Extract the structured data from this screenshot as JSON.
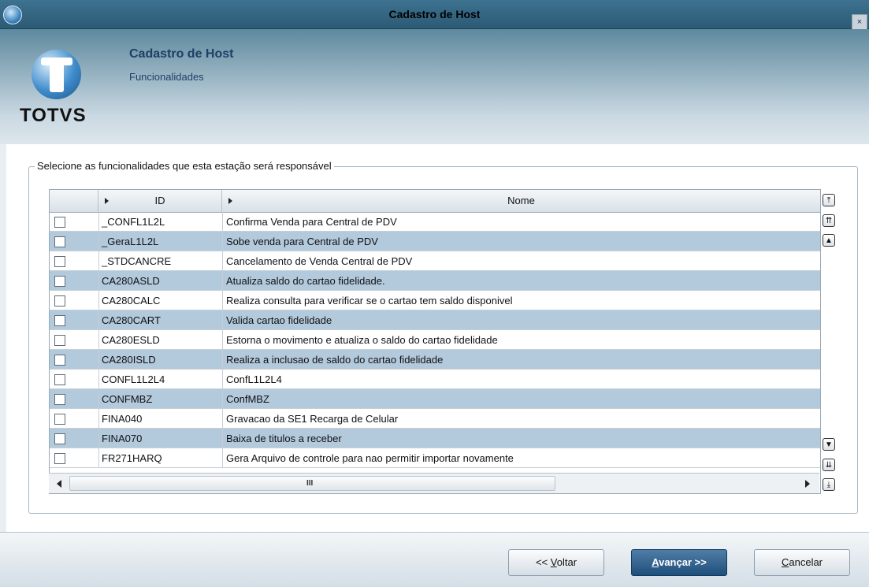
{
  "window": {
    "title": "Cadastro de Host",
    "close_label": "×"
  },
  "header": {
    "logo_text": "TOTVS",
    "title": "Cadastro de Host",
    "subtitle": "Funcionalidades"
  },
  "group": {
    "label": "Selecione as funcionalidades que esta estação será responsável"
  },
  "grid": {
    "columns": {
      "id": "ID",
      "nome": "Nome"
    },
    "rows": [
      {
        "id": "_CONFL1L2L",
        "nome": "Confirma Venda para Central de PDV",
        "checked": false
      },
      {
        "id": "_GeraL1L2L",
        "nome": "Sobe venda para Central de PDV",
        "checked": false
      },
      {
        "id": "_STDCANCRE",
        "nome": "Cancelamento de Venda Central de PDV",
        "checked": false
      },
      {
        "id": "CA280ASLD",
        "nome": "Atualiza saldo do cartao fidelidade.",
        "checked": false
      },
      {
        "id": "CA280CALC",
        "nome": "Realiza consulta para verificar se o cartao tem saldo disponivel",
        "checked": false
      },
      {
        "id": "CA280CART",
        "nome": "Valida cartao fidelidade",
        "checked": false
      },
      {
        "id": "CA280ESLD",
        "nome": "Estorna o movimento e atualiza o saldo do cartao fidelidade",
        "checked": false
      },
      {
        "id": "CA280ISLD",
        "nome": "Realiza a inclusao de saldo do cartao fidelidade",
        "checked": false
      },
      {
        "id": "CONFL1L2L4",
        "nome": "ConfL1L2L4",
        "checked": false
      },
      {
        "id": "CONFMBZ",
        "nome": "ConfMBZ",
        "checked": false
      },
      {
        "id": "FINA040",
        "nome": "Gravacao da SE1 Recarga de Celular",
        "checked": false
      },
      {
        "id": "FINA070",
        "nome": "Baixa de titulos a receber",
        "checked": false
      },
      {
        "id": "FR271HARQ",
        "nome": "Gera Arquivo de controle para nao permitir importar novamente",
        "checked": false
      }
    ],
    "scroll_grip": "III"
  },
  "nav_buttons": {
    "first": "⤒",
    "page_up": "⇈",
    "up": "▲",
    "down": "▼",
    "page_down": "⇊",
    "last": "⤓"
  },
  "footer": {
    "back_button": "<< Voltar",
    "next_button": "Avançar >>",
    "cancel_button": "Cancelar"
  },
  "colors": {
    "alt_row": "#b3c9dc",
    "primary_button": "#1f4f7c",
    "title_bar": "#2c5a75"
  }
}
